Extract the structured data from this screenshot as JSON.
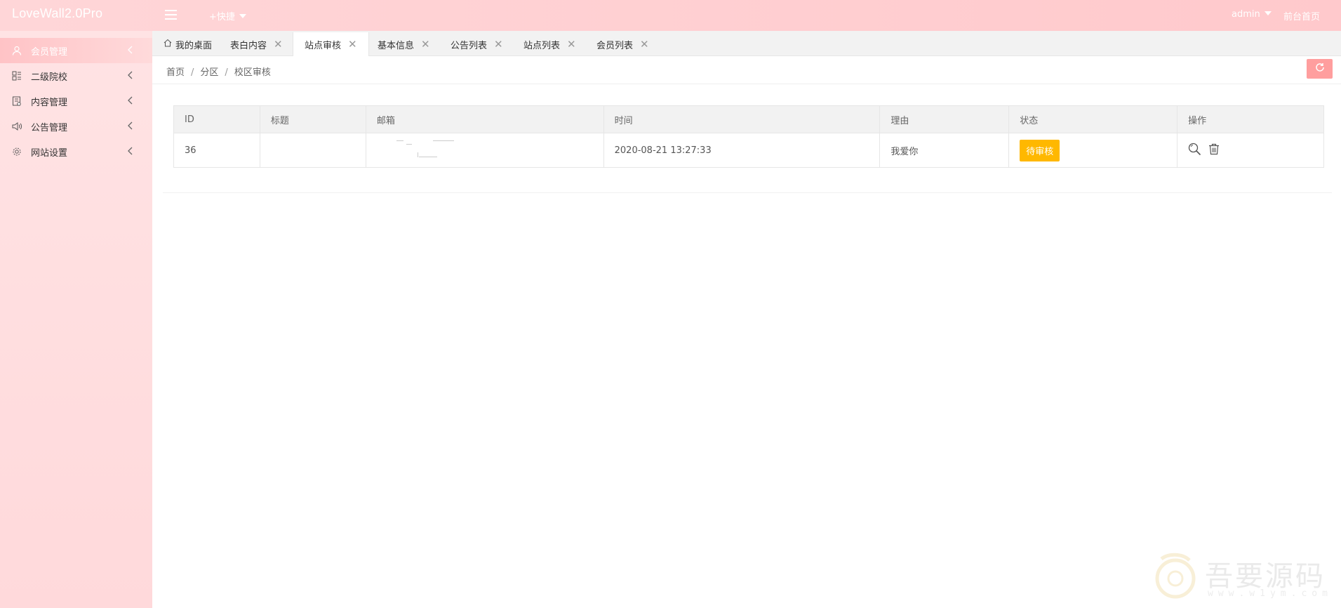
{
  "header": {
    "logo": "LoveWall2.0Pro",
    "quick_menu": "+快捷",
    "user": "admin",
    "front_link": "前台首页"
  },
  "sidebar": {
    "items": [
      {
        "label": "会员管理",
        "icon": "user-icon",
        "active": true
      },
      {
        "label": "二级院校",
        "icon": "apps-icon",
        "active": false
      },
      {
        "label": "内容管理",
        "icon": "document-icon",
        "active": false
      },
      {
        "label": "公告管理",
        "icon": "speaker-icon",
        "active": false
      },
      {
        "label": "网站设置",
        "icon": "gear-icon",
        "active": false
      }
    ]
  },
  "tabs": [
    {
      "label": "我的桌面",
      "icon": "home-icon",
      "closable": false
    },
    {
      "label": "表白内容",
      "closable": true
    },
    {
      "label": "站点审核",
      "closable": true,
      "active": true
    },
    {
      "label": "基本信息",
      "closable": true
    },
    {
      "label": "公告列表",
      "closable": true
    },
    {
      "label": "站点列表",
      "closable": true
    },
    {
      "label": "会员列表",
      "closable": true
    }
  ],
  "breadcrumb": [
    "首页",
    "分区",
    "校区审核"
  ],
  "table": {
    "headers": [
      "ID",
      "标题",
      "邮箱",
      "时间",
      "理由",
      "状态",
      "操作"
    ],
    "rows": [
      {
        "id": "36",
        "title": "",
        "email": "",
        "time": "2020-08-21 13:27:33",
        "reason": "我爱你",
        "status": "待审核"
      }
    ]
  },
  "watermark": {
    "text": "吾要源码",
    "url": "www.w1ym.com"
  },
  "colors": {
    "accent": "#ffc9cc",
    "status_pending": "#ffb800",
    "refresh_button": "#ff9e9e"
  }
}
